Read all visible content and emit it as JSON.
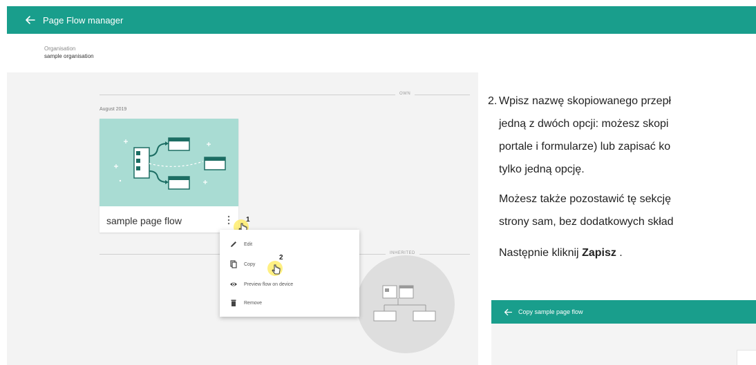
{
  "app": {
    "title": "Page Flow manager",
    "accent": "#199e8c"
  },
  "org": {
    "label": "Organisation",
    "value": "sample organisation"
  },
  "sections": {
    "own": "OWN",
    "inherited": "INHERITED"
  },
  "group": {
    "month": "August 2019"
  },
  "card": {
    "name": "sample page flow"
  },
  "menu": {
    "items": [
      {
        "label": "Edit",
        "icon": "pencil-icon"
      },
      {
        "label": "Copy",
        "icon": "copy-icon"
      },
      {
        "label": "Preview flow on device",
        "icon": "eye-icon"
      },
      {
        "label": "Remove",
        "icon": "trash-icon"
      }
    ]
  },
  "markers": {
    "first": "1",
    "second": "2"
  },
  "doc": {
    "step_number": "2.",
    "p1": [
      "Wpisz nazwę skopiowanego przepł",
      "jedną z dwóch opcji: możesz skopi",
      "portale i formularze) lub zapisać ko",
      "tylko jedną opcję."
    ],
    "p2": [
      "Możesz także pozostawić tę sekcję",
      "strony sam, bez dodatkowych skład"
    ],
    "p3_before": "Następnie kliknij ",
    "p3_bold": "Zapisz",
    "p3_after": " .",
    "screenshot_title": "Copy sample page flow"
  }
}
